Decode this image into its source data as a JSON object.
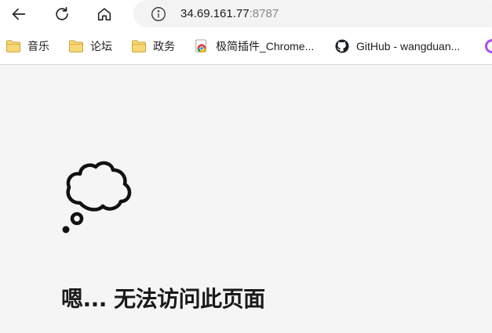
{
  "address_bar": {
    "url_host": "34.69.161.77",
    "url_port": ":8787"
  },
  "bookmarks": [
    {
      "label": "音乐",
      "icon": "folder-icon"
    },
    {
      "label": "论坛",
      "icon": "folder-icon"
    },
    {
      "label": "政务",
      "icon": "folder-icon"
    },
    {
      "label": "极简插件_Chrome...",
      "icon": "chrome-icon"
    },
    {
      "label": "GitHub - wangduan...",
      "icon": "github-icon"
    }
  ],
  "error": {
    "title": "嗯... 无法访问此页面"
  },
  "colors": {
    "toolbar_bg": "#ffffff",
    "page_bg": "#f5f5f5",
    "folder_yellow": "#f8d775",
    "folder_outline": "#c9a43a",
    "edge_purple": "#a64ef5"
  }
}
